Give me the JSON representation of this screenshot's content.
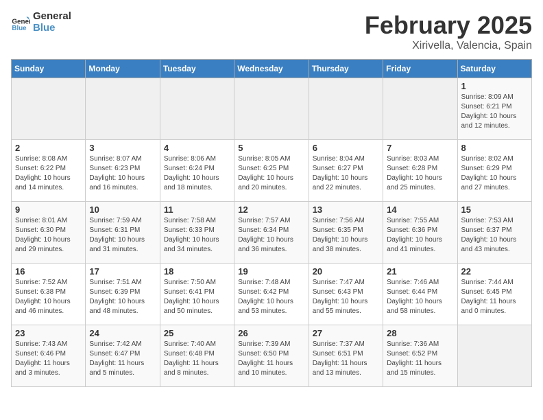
{
  "header": {
    "logo_general": "General",
    "logo_blue": "Blue",
    "month_title": "February 2025",
    "location": "Xirivella, Valencia, Spain"
  },
  "days_of_week": [
    "Sunday",
    "Monday",
    "Tuesday",
    "Wednesday",
    "Thursday",
    "Friday",
    "Saturday"
  ],
  "weeks": [
    [
      {
        "day": "",
        "info": ""
      },
      {
        "day": "",
        "info": ""
      },
      {
        "day": "",
        "info": ""
      },
      {
        "day": "",
        "info": ""
      },
      {
        "day": "",
        "info": ""
      },
      {
        "day": "",
        "info": ""
      },
      {
        "day": "1",
        "info": "Sunrise: 8:09 AM\nSunset: 6:21 PM\nDaylight: 10 hours\nand 12 minutes."
      }
    ],
    [
      {
        "day": "2",
        "info": "Sunrise: 8:08 AM\nSunset: 6:22 PM\nDaylight: 10 hours\nand 14 minutes."
      },
      {
        "day": "3",
        "info": "Sunrise: 8:07 AM\nSunset: 6:23 PM\nDaylight: 10 hours\nand 16 minutes."
      },
      {
        "day": "4",
        "info": "Sunrise: 8:06 AM\nSunset: 6:24 PM\nDaylight: 10 hours\nand 18 minutes."
      },
      {
        "day": "5",
        "info": "Sunrise: 8:05 AM\nSunset: 6:25 PM\nDaylight: 10 hours\nand 20 minutes."
      },
      {
        "day": "6",
        "info": "Sunrise: 8:04 AM\nSunset: 6:27 PM\nDaylight: 10 hours\nand 22 minutes."
      },
      {
        "day": "7",
        "info": "Sunrise: 8:03 AM\nSunset: 6:28 PM\nDaylight: 10 hours\nand 25 minutes."
      },
      {
        "day": "8",
        "info": "Sunrise: 8:02 AM\nSunset: 6:29 PM\nDaylight: 10 hours\nand 27 minutes."
      }
    ],
    [
      {
        "day": "9",
        "info": "Sunrise: 8:01 AM\nSunset: 6:30 PM\nDaylight: 10 hours\nand 29 minutes."
      },
      {
        "day": "10",
        "info": "Sunrise: 7:59 AM\nSunset: 6:31 PM\nDaylight: 10 hours\nand 31 minutes."
      },
      {
        "day": "11",
        "info": "Sunrise: 7:58 AM\nSunset: 6:33 PM\nDaylight: 10 hours\nand 34 minutes."
      },
      {
        "day": "12",
        "info": "Sunrise: 7:57 AM\nSunset: 6:34 PM\nDaylight: 10 hours\nand 36 minutes."
      },
      {
        "day": "13",
        "info": "Sunrise: 7:56 AM\nSunset: 6:35 PM\nDaylight: 10 hours\nand 38 minutes."
      },
      {
        "day": "14",
        "info": "Sunrise: 7:55 AM\nSunset: 6:36 PM\nDaylight: 10 hours\nand 41 minutes."
      },
      {
        "day": "15",
        "info": "Sunrise: 7:53 AM\nSunset: 6:37 PM\nDaylight: 10 hours\nand 43 minutes."
      }
    ],
    [
      {
        "day": "16",
        "info": "Sunrise: 7:52 AM\nSunset: 6:38 PM\nDaylight: 10 hours\nand 46 minutes."
      },
      {
        "day": "17",
        "info": "Sunrise: 7:51 AM\nSunset: 6:39 PM\nDaylight: 10 hours\nand 48 minutes."
      },
      {
        "day": "18",
        "info": "Sunrise: 7:50 AM\nSunset: 6:41 PM\nDaylight: 10 hours\nand 50 minutes."
      },
      {
        "day": "19",
        "info": "Sunrise: 7:48 AM\nSunset: 6:42 PM\nDaylight: 10 hours\nand 53 minutes."
      },
      {
        "day": "20",
        "info": "Sunrise: 7:47 AM\nSunset: 6:43 PM\nDaylight: 10 hours\nand 55 minutes."
      },
      {
        "day": "21",
        "info": "Sunrise: 7:46 AM\nSunset: 6:44 PM\nDaylight: 10 hours\nand 58 minutes."
      },
      {
        "day": "22",
        "info": "Sunrise: 7:44 AM\nSunset: 6:45 PM\nDaylight: 11 hours\nand 0 minutes."
      }
    ],
    [
      {
        "day": "23",
        "info": "Sunrise: 7:43 AM\nSunset: 6:46 PM\nDaylight: 11 hours\nand 3 minutes."
      },
      {
        "day": "24",
        "info": "Sunrise: 7:42 AM\nSunset: 6:47 PM\nDaylight: 11 hours\nand 5 minutes."
      },
      {
        "day": "25",
        "info": "Sunrise: 7:40 AM\nSunset: 6:48 PM\nDaylight: 11 hours\nand 8 minutes."
      },
      {
        "day": "26",
        "info": "Sunrise: 7:39 AM\nSunset: 6:50 PM\nDaylight: 11 hours\nand 10 minutes."
      },
      {
        "day": "27",
        "info": "Sunrise: 7:37 AM\nSunset: 6:51 PM\nDaylight: 11 hours\nand 13 minutes."
      },
      {
        "day": "28",
        "info": "Sunrise: 7:36 AM\nSunset: 6:52 PM\nDaylight: 11 hours\nand 15 minutes."
      },
      {
        "day": "",
        "info": ""
      }
    ]
  ]
}
